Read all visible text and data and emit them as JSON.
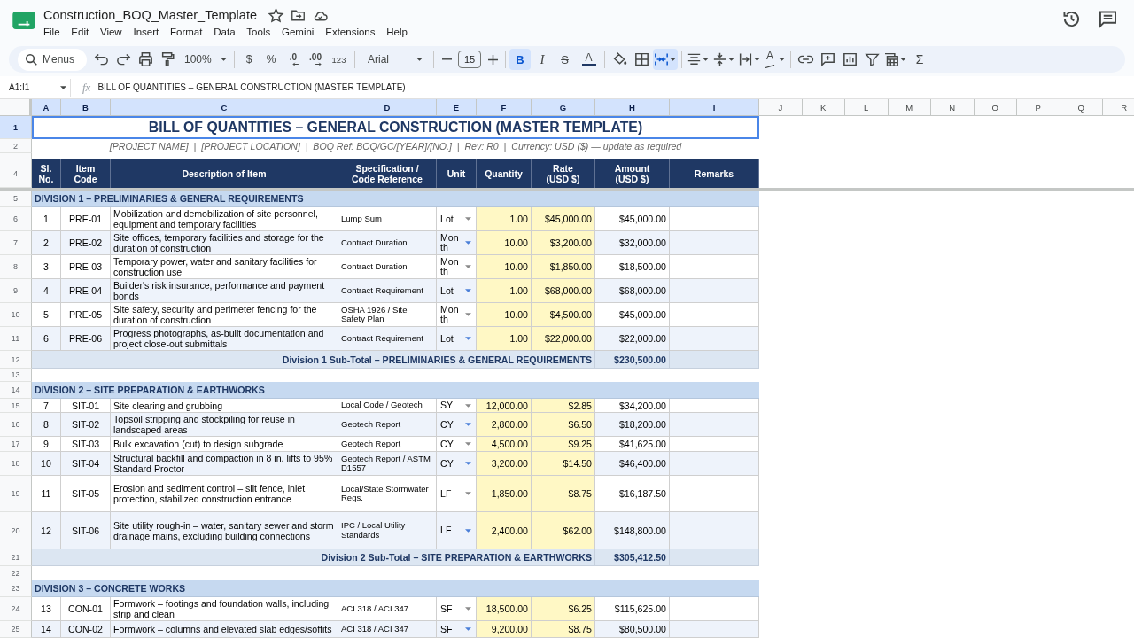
{
  "document": {
    "title": "Construction_BOQ_Master_Template"
  },
  "menu_bar": [
    "File",
    "Edit",
    "View",
    "Insert",
    "Format",
    "Data",
    "Tools",
    "Gemini",
    "Extensions",
    "Help"
  ],
  "toolbar": [
    {
      "kind": "search",
      "placeholder": "Menus"
    },
    {
      "kind": "undo"
    },
    {
      "kind": "redo"
    },
    {
      "kind": "print"
    },
    {
      "kind": "paint_format"
    },
    {
      "kind": "zoom",
      "label": "100%",
      "dropdown": true
    },
    {
      "kind": "separator"
    },
    {
      "kind": "currency",
      "label": "$"
    },
    {
      "kind": "percent",
      "label": "%"
    },
    {
      "kind": "decrease_decimals",
      "label": ".0"
    },
    {
      "kind": "increase_decimals",
      "label": ".00"
    },
    {
      "kind": "more_formats",
      "label": "123"
    },
    {
      "kind": "separator"
    },
    {
      "kind": "font",
      "label": "Arial",
      "dropdown": true
    },
    {
      "kind": "separator"
    },
    {
      "kind": "decrease_size"
    },
    {
      "kind": "font_size",
      "value": "15"
    },
    {
      "kind": "increase_size"
    },
    {
      "kind": "separator"
    },
    {
      "kind": "bold",
      "label": "B",
      "selected": true
    },
    {
      "kind": "italic",
      "label": "I",
      "selected": false
    },
    {
      "kind": "strikethrough",
      "label": "S",
      "selected": false
    },
    {
      "kind": "text_color",
      "label": "A"
    },
    {
      "kind": "separator"
    },
    {
      "kind": "fill_color"
    },
    {
      "kind": "borders"
    },
    {
      "kind": "merge",
      "selected": true,
      "dropdown": true
    },
    {
      "kind": "separator"
    },
    {
      "kind": "horizontal_align",
      "dropdown": true
    },
    {
      "kind": "vertical_align",
      "dropdown": true
    },
    {
      "kind": "wrap",
      "dropdown": true
    },
    {
      "kind": "text_rotation",
      "label": "A",
      "dropdown": true
    },
    {
      "kind": "separator"
    },
    {
      "kind": "link"
    },
    {
      "kind": "comment"
    },
    {
      "kind": "chart"
    },
    {
      "kind": "filter"
    },
    {
      "kind": "filter_views",
      "dropdown": true
    },
    {
      "kind": "functions",
      "label": "Σ"
    }
  ],
  "formula_bar": {
    "name_box": "A1:I1",
    "function_label": "fx",
    "formula": "BILL OF QUANTITIES – GENERAL CONSTRUCTION (MASTER TEMPLATE)"
  },
  "sheet": {
    "columns": [
      {
        "label": "A",
        "selected": true
      },
      {
        "label": "B",
        "selected": true
      },
      {
        "label": "C",
        "selected": true
      },
      {
        "label": "D",
        "selected": true
      },
      {
        "label": "E",
        "selected": true
      },
      {
        "label": "F",
        "selected": true
      },
      {
        "label": "G",
        "selected": true
      },
      {
        "label": "H",
        "selected": true
      },
      {
        "label": "I",
        "selected": true
      },
      {
        "label": "J",
        "selected": false
      },
      {
        "label": "K",
        "selected": false
      },
      {
        "label": "L",
        "selected": false
      },
      {
        "label": "M",
        "selected": false
      },
      {
        "label": "N",
        "selected": false
      },
      {
        "label": "O",
        "selected": false
      },
      {
        "label": "P",
        "selected": false
      },
      {
        "label": "Q",
        "selected": false
      },
      {
        "label": "R",
        "selected": false
      }
    ],
    "rows": [
      {
        "number": "1",
        "selected": true,
        "kind": "title",
        "text": "BILL OF QUANTITIES – GENERAL CONSTRUCTION (MASTER TEMPLATE)",
        "range_selected": true
      },
      {
        "number": "2",
        "selected": false,
        "kind": "subtitle",
        "text": "[PROJECT NAME]  |  [PROJECT LOCATION]  |  BOQ Ref: BOQ/GC/[YEAR]/[NO.]  |  Rev: R0  |  Currency: USD ($) — update as required"
      },
      {
        "selected": false,
        "kind": "spacer"
      },
      {
        "number": "4",
        "selected": false,
        "kind": "header",
        "cells": [
          "Sl. No.",
          "Item Code",
          "Description of Item",
          "Specification / Code Reference",
          "Unit",
          "Quantity",
          "Rate (USD $)",
          "Amount (USD $)",
          "Remarks"
        ]
      },
      {
        "number": "5",
        "selected": false,
        "kind": "division",
        "text": "DIVISION 1 – PRELIMINARIES & GENERAL REQUIREMENTS"
      },
      {
        "number": "6",
        "selected": false,
        "kind": "item",
        "sl_no": "1",
        "item_code": "PRE-01",
        "description": "Mobilization and demobilization of site personnel, equipment and temporary facilities",
        "specification": "Lump Sum",
        "unit": "Lot",
        "quantity": "1.00",
        "rate": "$45,000.00",
        "amount": "$45,000.00"
      },
      {
        "number": "7",
        "selected": false,
        "kind": "item",
        "sl_no": "2",
        "item_code": "PRE-02",
        "description": "Site offices, temporary facilities and storage for the duration of construction",
        "specification": "Contract Duration",
        "unit": "Month",
        "quantity": "10.00",
        "rate": "$3,200.00",
        "amount": "$32,000.00"
      },
      {
        "number": "8",
        "selected": false,
        "kind": "item",
        "sl_no": "3",
        "item_code": "PRE-03",
        "description": "Temporary power, water and sanitary facilities for construction use",
        "specification": "Contract Duration",
        "unit": "Month",
        "quantity": "10.00",
        "rate": "$1,850.00",
        "amount": "$18,500.00"
      },
      {
        "number": "9",
        "selected": false,
        "kind": "item",
        "sl_no": "4",
        "item_code": "PRE-04",
        "description": "Builder's risk insurance, performance and payment bonds",
        "specification": "Contract Requirement",
        "unit": "Lot",
        "quantity": "1.00",
        "rate": "$68,000.00",
        "amount": "$68,000.00"
      },
      {
        "number": "10",
        "selected": false,
        "kind": "item",
        "sl_no": "5",
        "item_code": "PRE-05",
        "description": "Site safety, security and perimeter fencing for the duration of construction",
        "specification": "OSHA 1926 / Site Safety Plan",
        "unit": "Month",
        "quantity": "10.00",
        "rate": "$4,500.00",
        "amount": "$45,000.00"
      },
      {
        "number": "11",
        "selected": false,
        "kind": "item",
        "sl_no": "6",
        "item_code": "PRE-06",
        "description": "Progress photographs, as-built documentation and project close-out submittals",
        "specification": "Contract Requirement",
        "unit": "Lot",
        "quantity": "1.00",
        "rate": "$22,000.00",
        "amount": "$22,000.00"
      },
      {
        "number": "12",
        "selected": false,
        "kind": "subtotal",
        "label": "Division 1 Sub-Total – PRELIMINARIES & GENERAL REQUIREMENTS",
        "amount": "$230,500.00"
      },
      {
        "number": "13",
        "selected": false,
        "kind": "blank"
      },
      {
        "number": "14",
        "selected": false,
        "kind": "division",
        "text": "DIVISION 2 – SITE PREPARATION & EARTHWORKS"
      },
      {
        "number": "15",
        "selected": false,
        "kind": "item",
        "sl_no": "7",
        "item_code": "SIT-01",
        "description": "Site clearing and grubbing",
        "specification": "Local Code / Geotech",
        "unit": "SY",
        "quantity": "12,000.00",
        "rate": "$2.85",
        "amount": "$34,200.00"
      },
      {
        "number": "16",
        "selected": false,
        "kind": "item",
        "sl_no": "8",
        "item_code": "SIT-02",
        "description": "Topsoil stripping and stockpiling for reuse in landscaped areas",
        "specification": "Geotech Report",
        "unit": "CY",
        "quantity": "2,800.00",
        "rate": "$6.50",
        "amount": "$18,200.00"
      },
      {
        "number": "17",
        "selected": false,
        "kind": "item",
        "sl_no": "9",
        "item_code": "SIT-03",
        "description": "Bulk excavation (cut) to design subgrade",
        "specification": "Geotech Report",
        "unit": "CY",
        "quantity": "4,500.00",
        "rate": "$9.25",
        "amount": "$41,625.00"
      },
      {
        "number": "18",
        "selected": false,
        "kind": "item",
        "sl_no": "10",
        "item_code": "SIT-04",
        "description": "Structural backfill and compaction in 8 in. lifts to 95% Standard Proctor",
        "specification": "Geotech Report / ASTM D1557",
        "unit": "CY",
        "quantity": "3,200.00",
        "rate": "$14.50",
        "amount": "$46,400.00"
      },
      {
        "number": "19",
        "selected": false,
        "kind": "item",
        "sl_no": "11",
        "item_code": "SIT-05",
        "description": "Erosion and sediment control – silt fence, inlet protection, stabilized construction entrance",
        "specification": "Local/State Stormwater Regs.",
        "unit": "LF",
        "quantity": "1,850.00",
        "rate": "$8.75",
        "amount": "$16,187.50"
      },
      {
        "number": "20",
        "selected": false,
        "kind": "item",
        "sl_no": "12",
        "item_code": "SIT-06",
        "description": "Site utility rough-in – water, sanitary sewer and storm drainage mains, excluding building connections",
        "specification": "IPC / Local Utility Standards",
        "unit": "LF",
        "quantity": "2,400.00",
        "rate": "$62.00",
        "amount": "$148,800.00"
      },
      {
        "number": "21",
        "selected": false,
        "kind": "subtotal",
        "label": "Division 2 Sub-Total – SITE PREPARATION & EARTHWORKS",
        "amount": "$305,412.50"
      },
      {
        "number": "22",
        "selected": false,
        "kind": "blank"
      },
      {
        "number": "23",
        "selected": false,
        "kind": "division",
        "text": "DIVISION 3 – CONCRETE WORKS"
      },
      {
        "number": "24",
        "selected": false,
        "kind": "item",
        "sl_no": "13",
        "item_code": "CON-01",
        "description": "Formwork – footings and foundation walls, including strip and clean",
        "specification": "ACI 318 / ACI 347",
        "unit": "SF",
        "quantity": "18,500.00",
        "rate": "$6.25",
        "amount": "$115,625.00"
      },
      {
        "number": "25",
        "selected": false,
        "kind": "item",
        "sl_no": "14",
        "item_code": "CON-02",
        "description": "Formwork – columns and elevated slab edges/soffits",
        "specification": "ACI 318 / ACI 347",
        "unit": "SF",
        "quantity": "9,200.00",
        "rate": "$8.75",
        "amount": "$80,500.00"
      }
    ]
  }
}
